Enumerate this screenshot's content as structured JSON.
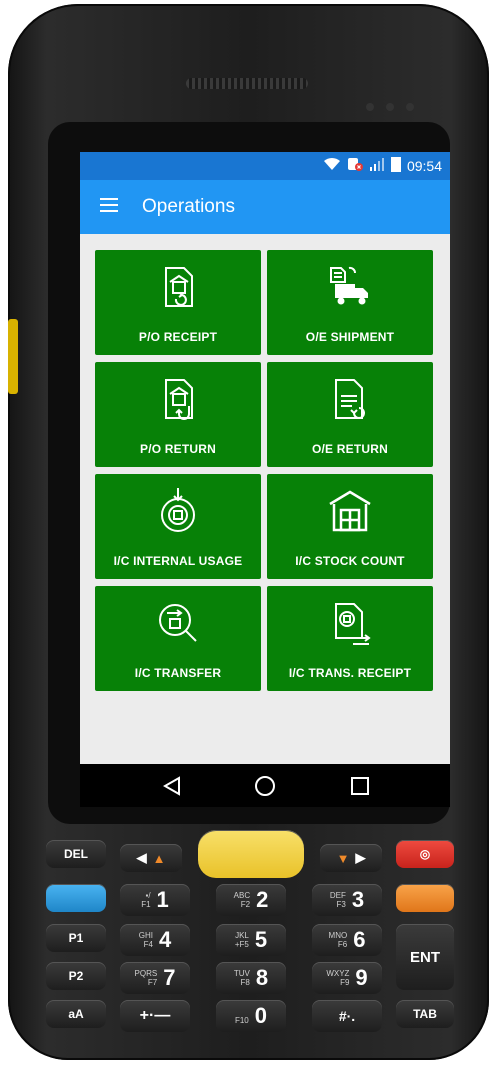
{
  "status_bar": {
    "time": "09:54",
    "icons": [
      "wifi-icon",
      "nfc-icon",
      "signal-icon",
      "battery-icon"
    ]
  },
  "app_bar": {
    "title": "Operations",
    "menu_icon": "hamburger-menu-icon"
  },
  "tiles": [
    {
      "label": "P/O RECEIPT",
      "icon": "po-receipt-icon"
    },
    {
      "label": "O/E SHIPMENT",
      "icon": "shipment-truck-icon"
    },
    {
      "label": "P/O RETURN",
      "icon": "po-return-icon"
    },
    {
      "label": "O/E RETURN",
      "icon": "document-return-icon"
    },
    {
      "label": "I/C INTERNAL USAGE",
      "icon": "internal-usage-icon"
    },
    {
      "label": "I/C STOCK COUNT",
      "icon": "warehouse-icon"
    },
    {
      "label": "I/C TRANSFER",
      "icon": "transfer-search-icon"
    },
    {
      "label": "I/C TRANS. RECEIPT",
      "icon": "transfer-receipt-icon"
    }
  ],
  "nav_bar": {
    "back": "back-triangle-icon",
    "home": "home-circle-icon",
    "recents": "recents-square-icon"
  },
  "keypad": {
    "keys": [
      {
        "main": "1",
        "sub": "▪/\nF1"
      },
      {
        "main": "2",
        "sub": "ABC\nF2"
      },
      {
        "main": "3",
        "sub": "DEF\nF3"
      },
      {
        "main": "4",
        "sub": "GHI\nF4"
      },
      {
        "main": "5",
        "sub": "JKL\n+F5"
      },
      {
        "main": "6",
        "sub": "MNO\nF6"
      },
      {
        "main": "7",
        "sub": "PQRS\nF7"
      },
      {
        "main": "8",
        "sub": "TUV\nF8"
      },
      {
        "main": "9",
        "sub": "WXYZ\nF9"
      },
      {
        "main": "0",
        "sub": "\nF10"
      }
    ],
    "side_keys": {
      "p1": "P1",
      "p2": "P2",
      "ent": "ENT",
      "tab": "TAB",
      "del": "DEL",
      "shift": "aA"
    },
    "colors": {
      "blue_key": "#2b9be0",
      "orange_key": "#f08a2a",
      "red_key": "#e0312a",
      "scan_key": "#f5d43c"
    }
  },
  "colors": {
    "status_bar": "#1976d2",
    "app_bar": "#2196f3",
    "tile": "#078107",
    "background": "#ececec"
  }
}
